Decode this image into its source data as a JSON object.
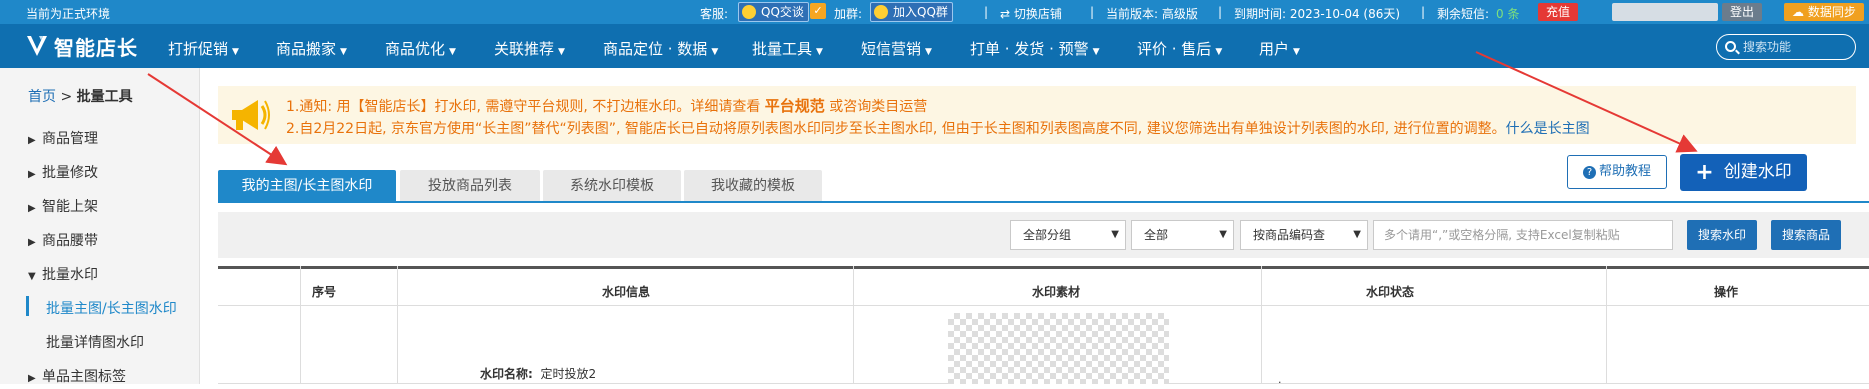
{
  "top_bar": {
    "env_text": "当前为正式环境",
    "service_label": "客服:",
    "qq_chat_button": "QQ交谈",
    "join_group_label": "加群:",
    "join_qq_group_button": "加入QQ群",
    "switch_shop": "⇄ 切换店铺",
    "current_version": "当前版本: 高级版",
    "expire": "到期时间: 2023-10-04 (86天)",
    "sms_label": "剩余短信:",
    "sms_value": "0 条",
    "recharge_button": "充值",
    "logout_button": "登出",
    "data_sync_button": "数据同步"
  },
  "nav": {
    "logo_text": "智能店长",
    "items": [
      "打折促销",
      "商品搬家",
      "商品优化",
      "关联推荐",
      "商品定位 · 数据",
      "批量工具",
      "短信营销",
      "打单 · 发货 · 预警",
      "评价 · 售后",
      "用户"
    ],
    "search_placeholder": "搜索功能"
  },
  "sidebar": {
    "breadcrumb_home": "首页",
    "breadcrumb_sep": ">",
    "breadcrumb_current": "批量工具",
    "items": [
      "商品管理",
      "批量修改",
      "智能上架",
      "商品腰带",
      "批量水印"
    ],
    "sub_items": [
      "批量主图/长主图水印",
      "批量详情图水印"
    ],
    "last_item": "单品主图标签"
  },
  "notice": {
    "line1_prefix": "1.通知: 用【智能店长】打水印, 需遵守平台规则, 不打边框水印。详细请查看",
    "line1_emph": "平台规范",
    "line1_suffix": "或咨询类目运营",
    "line2_text": "2.自2月22日起, 京东官方使用“长主图”替代“列表图”, 智能店长已自动将原列表图水印同步至长主图水印, 但由于长主图和列表图高度不同, 建议您筛选出有单独设计列表图的水印, 进行位置的调整。",
    "line2_link": "什么是长主图"
  },
  "tabs": [
    "我的主图/长主图水印",
    "投放商品列表",
    "系统水印模板",
    "我收藏的模板"
  ],
  "help_button": "帮助教程",
  "create_button": "创建水印",
  "filters": {
    "group_select": "全部分组",
    "status_select": "全部",
    "code_select": "按商品编码查",
    "search_placeholder": "多个请用“,”或空格分隔, 支持Excel复制粘贴",
    "search_watermark_button": "搜索水印",
    "search_product_button": "搜索商品"
  },
  "table": {
    "headers": [
      "序号",
      "水印信息",
      "水印素材",
      "水印状态",
      "操作"
    ],
    "rows": [
      {
        "name_label": "水印名称:",
        "name_value": "定时投放2"
      }
    ]
  },
  "colors": {
    "top_bar": "#1f88c9",
    "nav_bar": "#0f6fb0",
    "accent": "#1f88c9",
    "notice_text": "#e8720c",
    "arrow": "#e53935"
  }
}
